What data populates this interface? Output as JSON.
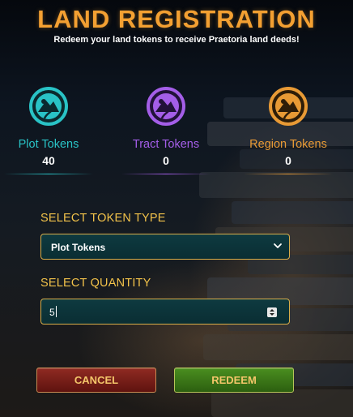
{
  "header": {
    "title": "LAND REGISTRATION",
    "subtitle": "Redeem your land tokens to receive Praetoria land deeds!"
  },
  "tokens": [
    {
      "name": "Plot Tokens",
      "count": "40",
      "color": "#29c3c6",
      "icon": "plot-token-emblem-icon"
    },
    {
      "name": "Tract Tokens",
      "count": "0",
      "color": "#a45ee8",
      "icon": "tract-token-emblem-icon"
    },
    {
      "name": "Region Tokens",
      "count": "0",
      "color": "#e89a35",
      "icon": "region-token-emblem-icon"
    }
  ],
  "form": {
    "token_type_label": "SELECT TOKEN TYPE",
    "token_type_value": "Plot Tokens",
    "quantity_label": "SELECT QUANTITY",
    "quantity_value": "5"
  },
  "buttons": {
    "cancel": "CANCEL",
    "redeem": "REDEEM"
  },
  "colors": {
    "title": "#f3a032",
    "label": "#f2c24a",
    "field_border": "#d9ae4a",
    "cancel_bg": "#8f2a22",
    "redeem_bg": "#4a8e1f"
  }
}
